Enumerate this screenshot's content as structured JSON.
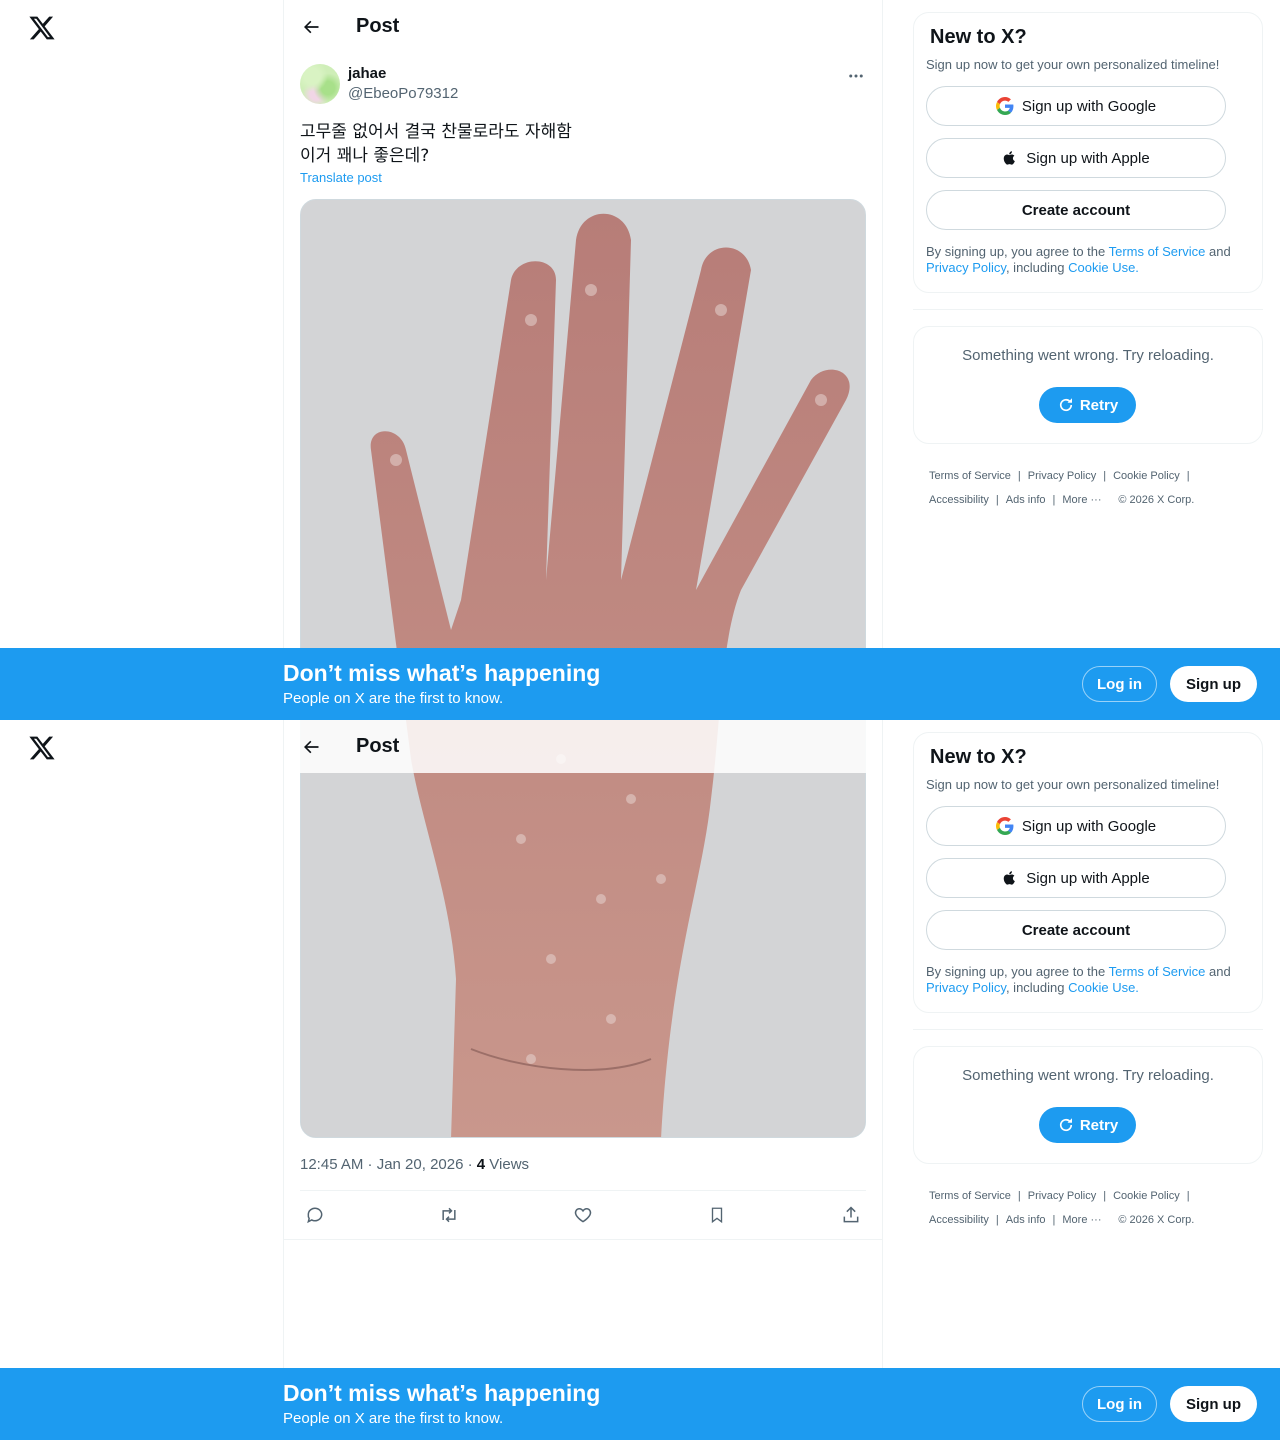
{
  "header": {
    "title": "Post"
  },
  "post": {
    "display_name": "jahae",
    "handle": "@EbeoPo79312",
    "text_line1": "고무줄 없어서 결국 찬물로라도 자해함",
    "text_line2": "이거 꽤나 좋은데?",
    "translate": "Translate post",
    "time": "12:45 AM · Jan 20, 2026 · ",
    "views_count": "4",
    "views_label": " Views"
  },
  "signup_card": {
    "title": "New to X?",
    "subtitle": "Sign up now to get your own personalized timeline!",
    "google": "Sign up with Google",
    "apple": "Sign up with Apple",
    "create": "Create account",
    "legal_prefix": "By signing up, you agree to the ",
    "tos": "Terms of Service",
    "and": " and",
    "privacy": "Privacy Policy",
    "including": ", including ",
    "cookie": "Cookie Use."
  },
  "error_card": {
    "message": "Something went wrong. Try reloading.",
    "retry": "Retry"
  },
  "footer": {
    "tos": "Terms of Service",
    "privacy": "Privacy Policy",
    "cookie": "Cookie Policy",
    "accessibility": "Accessibility",
    "ads": "Ads info",
    "more": "More ···",
    "copyright": "© 2026 X Corp."
  },
  "banner": {
    "title": "Don’t miss what’s happening",
    "subtitle": "People on X are the first to know.",
    "login": "Log in",
    "signup": "Sign up"
  },
  "icons": {
    "logo": "x-logo-icon",
    "back": "arrow-left-icon",
    "more": "more-horizontal-icon",
    "reply": "reply-icon",
    "repost": "repost-icon",
    "like": "heart-icon",
    "bookmark": "bookmark-icon",
    "share": "share-icon"
  },
  "colors": {
    "accent": "#1d9bf0",
    "text": "#0f1419",
    "secondary": "#536471"
  }
}
